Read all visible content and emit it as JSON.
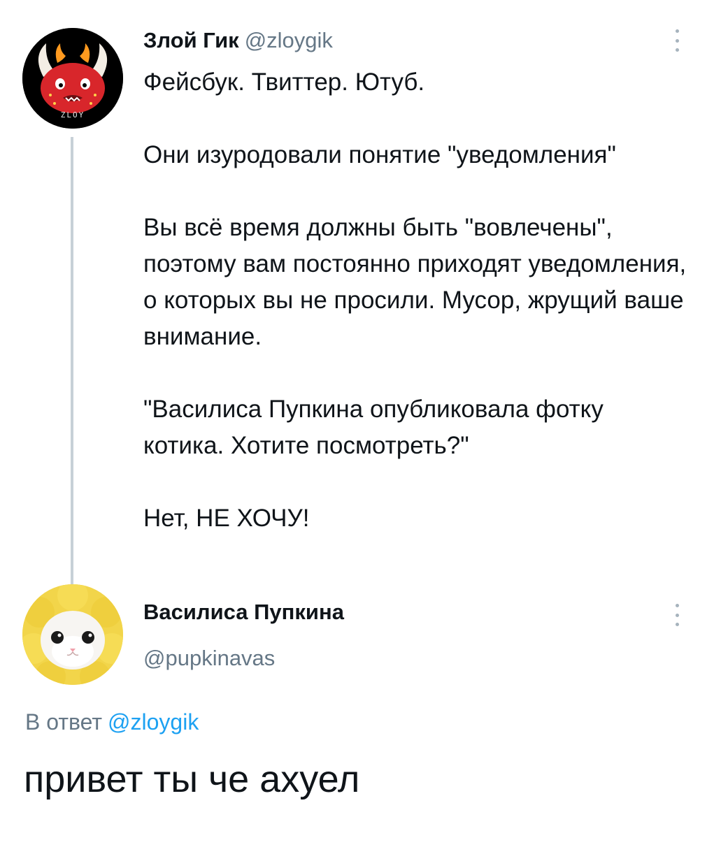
{
  "tweet": {
    "display_name": "Злой Гик",
    "handle": "@zloygik",
    "avatar_icon": "devil-avatar",
    "avatar_text": "ZLOY",
    "paragraphs": [
      "Фейсбук. Твиттер. Ютуб.",
      "Они изуродовали понятие \"уведомления\"",
      "Вы всё время должны быть \"вовлечены\", поэтому вам постоянно приходят уведомления, о которых вы не просили. Мусор, жрущий ваше внимание.",
      "\"Василиса Пупкина опубликовала фотку котика. Хотите посмотреть?\"",
      "Нет, НЕ ХОЧУ!"
    ]
  },
  "reply": {
    "display_name": "Василиса Пупкина",
    "handle": "@pupkinavas",
    "avatar_icon": "cat-in-flower-hat-avatar",
    "reply_to_label": "В ответ",
    "reply_to_handle": "@zloygik",
    "text": "привет ты че ахуел"
  },
  "colors": {
    "link": "#1da1f2",
    "secondary_text": "#657786",
    "thread_line": "#c7d0d7"
  }
}
